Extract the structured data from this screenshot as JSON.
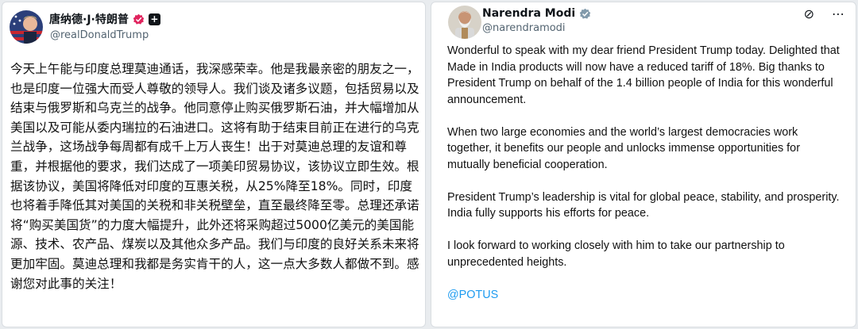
{
  "left_post": {
    "display_name": "唐纳德·J·特朗普",
    "handle": "@realDonaldTrump",
    "badge_icon": "verified-pink-badge-icon",
    "square_icon": "plus-square-icon",
    "body": "今天上午能与印度总理莫迪通话，我深感荣幸。他是我最亲密的朋友之一，也是印度一位强大而受人尊敬的领导人。我们谈及诸多议题，包括贸易以及结束与俄罗斯和乌克兰的战争。他同意停止购买俄罗斯石油，并大幅增加从美国以及可能从委内瑞拉的石油进口。这将有助于结束目前正在进行的乌克兰战争，这场战争每周都有成千上万人丧生！出于对莫迪总理的友谊和尊重，并根据他的要求，我们达成了一项美印贸易协议，该协议立即生效。根据该协议，美国将降低对印度的互惠关税，从25%降至18%。同时，印度也将着手降低其对美国的关税和非关税壁垒，直至最终降至零。总理还承诺将“购买美国货”的力度大幅提升，此外还将采购超过5000亿美元的美国能源、技术、农产品、煤炭以及其他众多产品。我们与印度的良好关系未来将更加牢固。莫迪总理和我都是务实肯干的人，这一点大多数人都做不到。感谢您对此事的关注！"
  },
  "right_post": {
    "display_name": "Narendra Modi",
    "handle": "@narendramodi",
    "badge_icon": "verified-gray-badge-icon",
    "actions": [
      "grok-icon",
      "more-icon"
    ],
    "actions_text": [
      "⊘",
      "⋯"
    ],
    "paragraphs": [
      "Wonderful to speak with my dear friend President Trump today. Delighted that Made in India products will now have a reduced tariff of 18%. Big thanks to President Trump on behalf of the 1.4 billion people of India for this wonderful announcement.",
      "When two large economies and the world’s largest democracies work together, it benefits our people and unlocks immense opportunities for mutually beneficial cooperation.",
      "President Trump’s leadership is vital for global peace, stability, and prosperity. India fully supports his efforts for peace.",
      "I look forward to working closely with him to take our partnership to unprecedented heights."
    ],
    "mention": "@POTUS"
  },
  "colors": {
    "link": "#1d9bf0",
    "handle": "#536471",
    "pink_badge": "#e0245e",
    "gray_badge": "#829aab"
  }
}
